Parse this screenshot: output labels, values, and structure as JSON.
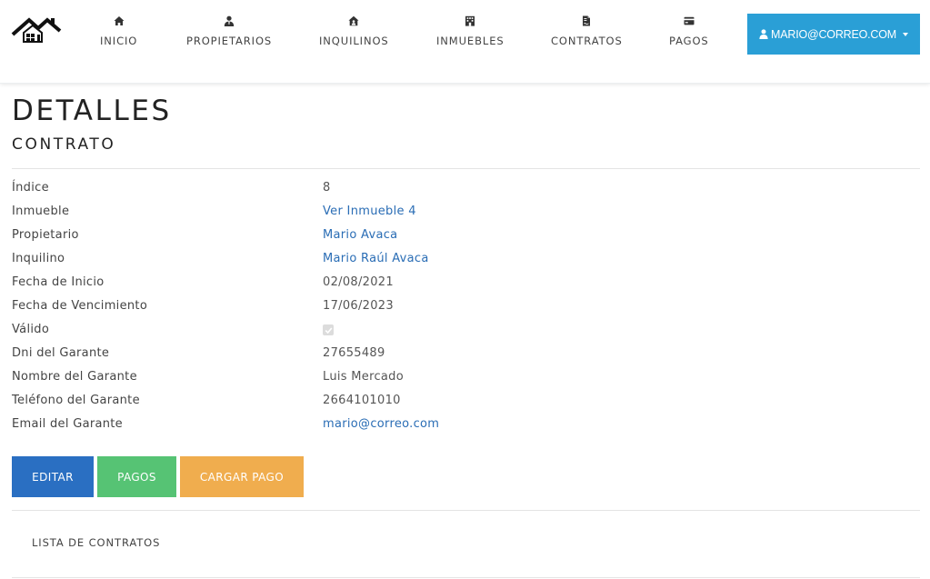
{
  "nav": {
    "logo_icon": "house-logo-icon",
    "items": [
      {
        "label": "INICIO",
        "icon": "home-icon"
      },
      {
        "label": "PROPIETARIOS",
        "icon": "user-tie-icon"
      },
      {
        "label": "INQUILINOS",
        "icon": "house-user-icon"
      },
      {
        "label": "INMUEBLES",
        "icon": "building-icon"
      },
      {
        "label": "CONTRATOS",
        "icon": "file-contract-icon"
      },
      {
        "label": "PAGOS",
        "icon": "credit-card-icon"
      }
    ],
    "user": {
      "label": "MARIO@CORREO.COM",
      "icon": "user-icon",
      "color": "#2a9fd6"
    }
  },
  "page": {
    "title": "DETALLES",
    "subtitle": "CONTRATO"
  },
  "details": [
    {
      "label": "Índice",
      "value": "8",
      "type": "text"
    },
    {
      "label": "Inmueble",
      "value": "Ver Inmueble 4",
      "type": "link"
    },
    {
      "label": "Propietario",
      "value": "Mario Avaca",
      "type": "link"
    },
    {
      "label": "Inquilino",
      "value": "Mario Raúl Avaca",
      "type": "link"
    },
    {
      "label": "Fecha de Inicio",
      "value": "02/08/2021",
      "type": "text"
    },
    {
      "label": "Fecha de Vencimiento",
      "value": "17/06/2023",
      "type": "text"
    },
    {
      "label": "Válido",
      "checked": true,
      "type": "checkbox"
    },
    {
      "label": "Dni del Garante",
      "value": "27655489",
      "type": "text"
    },
    {
      "label": "Nombre del Garante",
      "value": "Luis Mercado",
      "type": "text"
    },
    {
      "label": "Teléfono del Garante",
      "value": "2664101010",
      "type": "text"
    },
    {
      "label": "Email del Garante",
      "value": "mario@correo.com",
      "type": "link"
    }
  ],
  "actions": {
    "edit": {
      "label": "EDITAR",
      "color": "#2a6fc2"
    },
    "payments": {
      "label": "PAGOS",
      "color": "#56c374"
    },
    "add_payment": {
      "label": "CARGAR PAGO",
      "color": "#f0ad4e"
    }
  },
  "back_link": "LISTA DE CONTRATOS",
  "colors": {
    "link": "#2a6db5",
    "text": "#444444"
  }
}
